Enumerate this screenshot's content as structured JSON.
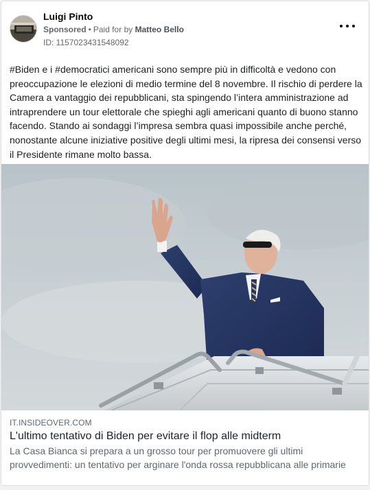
{
  "post": {
    "author": "Luigi Pinto",
    "sponsored_label": "Sponsored",
    "dot": "•",
    "paid_for_prefix": "Paid for by",
    "payer": "Matteo Bello",
    "id_line": "ID: 1157023431548092",
    "text": "#Biden e i #democratici americani sono sempre più in difficoltà e vedono con preoccupazione le elezioni di medio termine del 8 novembre. Il rischio di perdere la Camera a vantaggio dei repubblicani, sta spingendo l’intera amministrazione ad intraprendere un tour elettorale che spieghi agli americani quanto di buono stanno facendo. Stando ai sondaggi l’impresa sembra quasi impossibile anche perché, nonostante alcune iniziative positive degli ultimi mesi, la ripresa dei consensi verso il Presidente rimane molto bassa."
  },
  "link": {
    "domain": "IT.INSIDEOVER.COM",
    "headline": "L'ultimo tentativo di Biden per evitare il flop alle midterm",
    "description": "La Casa Bianca si prepara a un grosso tour per promuovere gli ultimi provvedimenti: un tentativo per arginare l'onda rossa repubblicana alle primarie"
  },
  "icons": {
    "more_options": "more-options-icon",
    "avatar": "profile-avatar"
  },
  "colors": {
    "link": "#385898",
    "muted": "#65676b",
    "background": "#f0f2f5"
  }
}
